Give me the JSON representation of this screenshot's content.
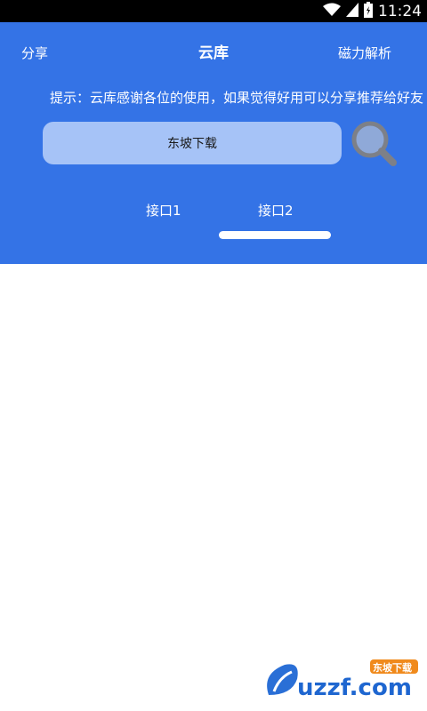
{
  "status_bar": {
    "time": "11:24",
    "icons": [
      "wifi-icon",
      "signal-icon",
      "battery-icon"
    ]
  },
  "header": {
    "share_label": "分享",
    "title": "云库",
    "magnet_label": "磁力解析",
    "tip": "提示：云库感谢各位的使用，如果觉得好用可以分享推荐给好友"
  },
  "search": {
    "value": "东坡下载",
    "icon": "search-icon"
  },
  "tabs": [
    {
      "label": "接口1",
      "selected": false
    },
    {
      "label": "接口2",
      "selected": true
    }
  ],
  "watermark": {
    "brand_text": "uzzf.com",
    "badge_text": "东坡下载"
  },
  "colors": {
    "header_bg": "#3473E6",
    "search_bg": "#A6C3F7",
    "status_bg": "#000000"
  }
}
